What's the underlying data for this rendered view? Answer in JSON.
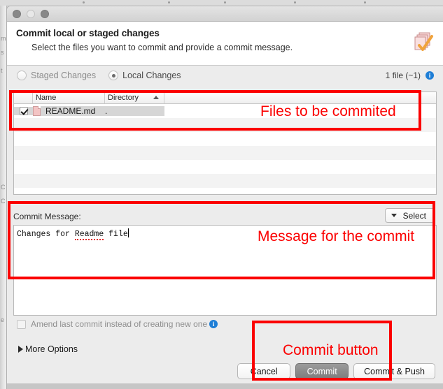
{
  "window": {
    "traffic_lights": [
      "close",
      "minimize",
      "zoom"
    ]
  },
  "header": {
    "title": "Commit local or staged changes",
    "subtitle": "Select the files you want to commit and provide a commit message.",
    "icon": "commit-document-check-icon"
  },
  "changes_toolbar": {
    "staged_radio_label": "Staged Changes",
    "local_radio_label": "Local Changes",
    "selected": "Local Changes",
    "file_count": "1 file (~1)",
    "info_icon": "info-icon"
  },
  "file_table": {
    "columns": [
      "",
      "Name",
      "Directory",
      ""
    ],
    "sort_column": "Directory",
    "sort_direction": "ascending",
    "rows": [
      {
        "checked": true,
        "name": "README.md",
        "directory": "."
      }
    ]
  },
  "commit_message": {
    "label": "Commit Message:",
    "select_button": "Select",
    "select_icon": "chevron-down-icon",
    "value_before": "Changes for ",
    "value_misspelled": "Readme",
    "value_after": " file"
  },
  "amend": {
    "label": "Amend last commit instead of creating new one",
    "checked": false,
    "info_icon": "info-icon"
  },
  "more_options": {
    "label": "More Options",
    "disclosure_icon": "triangle-right-icon",
    "expanded": false
  },
  "buttons": {
    "cancel": "Cancel",
    "commit": "Commit",
    "commit_and_push": "Commit & Push"
  },
  "annotations": [
    {
      "text": "Files to be commited"
    },
    {
      "text": "Message for the commit"
    },
    {
      "text": "Commit button"
    }
  ],
  "colors": {
    "annotation_red": "#fb0000",
    "info_blue": "#1e7ed6",
    "file_icon_pink": "#f3c4c4",
    "default_button_gray": "#8c8c8c"
  }
}
